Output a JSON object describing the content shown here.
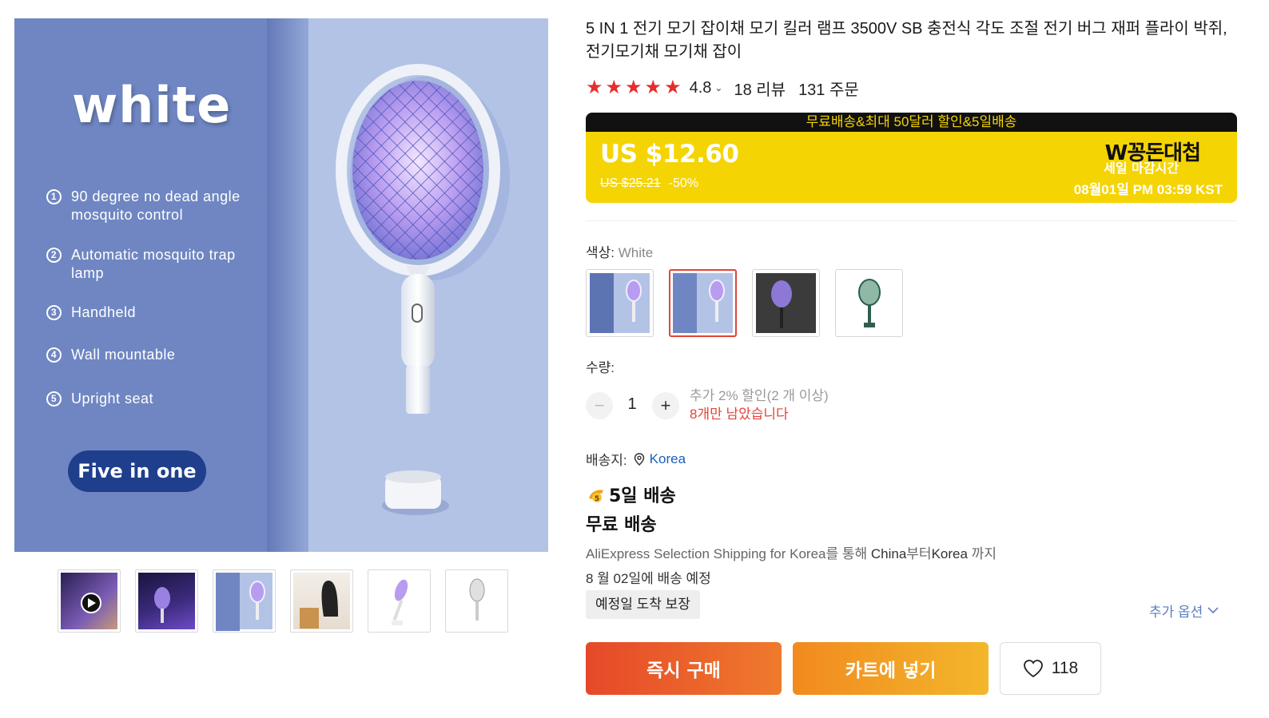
{
  "gallery": {
    "main_image": {
      "color_title": "white",
      "features": [
        {
          "num": "1",
          "text": "90 degree no dead angle mosquito control"
        },
        {
          "num": "2",
          "text": "Automatic mosquito trap lamp"
        },
        {
          "num": "3",
          "text": "Handheld"
        },
        {
          "num": "4",
          "text": "Wall mountable"
        },
        {
          "num": "5",
          "text": "Upright seat"
        }
      ],
      "badge": "Five in one"
    },
    "thumbnails": [
      "video",
      "night-lamp",
      "white-card",
      "wall-room",
      "white-racket",
      "white-racket-side"
    ]
  },
  "product": {
    "title": "5 IN 1 전기 모기 잡이채 모기 킬러 램프 3500V SB 충전식 각도 조절 전기 버그 재퍼 플라이 박쥐, 전기모기채 모기채 잡이",
    "rating": "4.8",
    "star_count": 5,
    "reviews": "18 리뷰",
    "orders": "131 주문"
  },
  "promo": {
    "banner": "무료배송&최대 50달러 할인&5일배송",
    "price": "US $12.60",
    "original_price": "US $25.21",
    "discount": "-50%",
    "sale_name": "W꽁돈대첩",
    "sale_subtitle": "세일 마감시간",
    "sale_end": "08월01일 PM 03:59 KST",
    "colors": {
      "bar": "#111111",
      "bg": "#f5d404",
      "bar_text": "#f5d404"
    }
  },
  "color": {
    "label": "색상: ",
    "selected": "White",
    "options": [
      "green-card",
      "white-card",
      "black-night",
      "green-racket"
    ],
    "selected_index": 1
  },
  "quantity": {
    "label": "수량:",
    "value": "1",
    "minus": "−",
    "plus": "+",
    "extra_discount": "추가 2% 할인(2 개 이상)",
    "stock_left": "8개만 남았습니다"
  },
  "shipping": {
    "label": "배송지:",
    "country": "Korea",
    "days": "5일 배송",
    "free": "무료 배송",
    "via_service": "AliExpress Selection Shipping for Korea",
    "via_1": "를 통해 ",
    "via_from": "China",
    "via_2": "부터",
    "via_to": "Korea",
    "via_3": " 까지",
    "eta_pre": "8 월 02일",
    "eta_post": "에 배송 예정",
    "guarantee": "예정일 도착 보장",
    "more_options": "추가 옵션"
  },
  "actions": {
    "buy_now": "즉시 구매",
    "add_cart": "카트에 넣기",
    "wishlist_count": "118"
  },
  "theme": {
    "accent_red": "#e62e2e",
    "link_blue": "#1c5fb9"
  }
}
